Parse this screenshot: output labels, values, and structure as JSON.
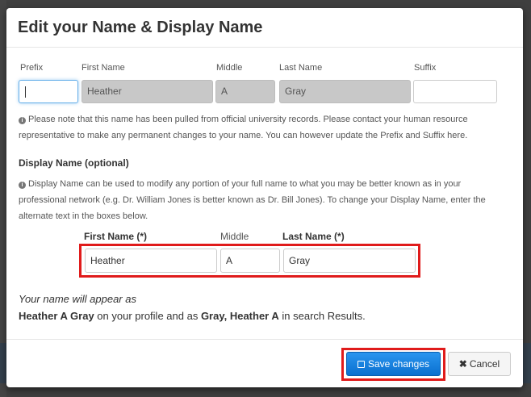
{
  "modal": {
    "title": "Edit your Name & Display Name"
  },
  "name": {
    "prefix_label": "Prefix",
    "first_label": "First Name",
    "middle_label": "Middle",
    "last_label": "Last Name",
    "suffix_label": "Suffix",
    "prefix_value": "",
    "first_value": "Heather",
    "middle_value": "A",
    "last_value": "Gray",
    "suffix_value": "",
    "note_line1": "Please note that this name has been pulled from official university records. Please contact your human resource",
    "note_line2": "representative to make any permanent changes to your name. You can however update the Prefix and Suffix here."
  },
  "display": {
    "section_title": "Display Name (optional)",
    "help_line1": "Display Name can be used to modify any portion of your full name to what you may be better known as in your",
    "help_line2": "professional network (e.g. Dr. William Jones is better known as Dr. Bill Jones). To change your Display Name, enter the",
    "help_line3": "alternate text in the boxes below.",
    "first_label": "First Name (*)",
    "middle_label": "Middle",
    "last_label": "Last Name (*)",
    "first_value": "Heather",
    "middle_value": "A",
    "last_value": "Gray"
  },
  "preview": {
    "intro": "Your name will appear as",
    "profile_name": "Heather A Gray",
    "mid_text": " on your profile and as ",
    "search_name": "Gray, Heather A",
    "end_text": " in search Results."
  },
  "footer": {
    "save_label": "Save changes",
    "cancel_label": "Cancel"
  },
  "icons": [
    "info-icon",
    "floppy-disk-icon",
    "close-icon"
  ],
  "colors": {
    "primary": "#0a7ee0",
    "highlight": "#e01b1b",
    "readonly": "#c8c8c8"
  }
}
